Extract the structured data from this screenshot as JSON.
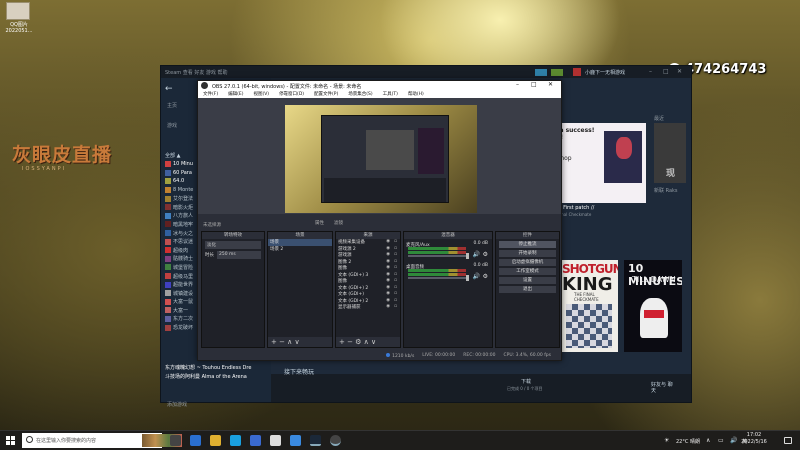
{
  "desktop": {
    "icon_label": "QQ图片\n2022051..."
  },
  "streamer": {
    "logo": "灰眼皮直播",
    "subtitle": "IOSSYANPI"
  },
  "qq": {
    "number": "474264743"
  },
  "steam": {
    "nav": "Steam  查看  好友  游戏  帮助",
    "user": "小鹿下一无相游戏",
    "home": "主页",
    "section": "游戏",
    "list_header": "全部 ▲",
    "games": [
      {
        "name": "10 Minu",
        "color": "#d04040"
      },
      {
        "name": "60 Para",
        "color": "#4060a0"
      },
      {
        "name": "64.0",
        "color": "#a0a040"
      },
      {
        "name": "8 Monte",
        "color": "#c08030"
      },
      {
        "name": "艾尔登法",
        "color": "#a08030"
      },
      {
        "name": "暗影火炬",
        "color": "#803030"
      },
      {
        "name": "八方旅人",
        "color": "#4080c0"
      },
      {
        "name": "暗黑地牢",
        "color": "#602020"
      },
      {
        "name": "冰与火之",
        "color": "#3060a0"
      },
      {
        "name": "不思议迷",
        "color": "#c05050"
      },
      {
        "name": "超级肉",
        "color": "#d03030"
      },
      {
        "name": "骷髅骑士",
        "color": "#804080"
      },
      {
        "name": "城堡冒险",
        "color": "#408040"
      },
      {
        "name": "超级马里",
        "color": "#c04040"
      },
      {
        "name": "超能世界",
        "color": "#4040c0"
      },
      {
        "name": "城镇建设",
        "color": "#a0a0a0"
      },
      {
        "name": "大富一鼠",
        "color": "#d05050"
      },
      {
        "name": "大富一",
        "color": "#c06060"
      },
      {
        "name": "东方二次",
        "color": "#6060a0"
      },
      {
        "name": "恐龙破坏",
        "color": "#a04040"
      }
    ],
    "bottom_items": [
      "东方魂魄幻想 ~ Touhou Endless Dre",
      "斗技场的阿利曼 Alma of the Arena"
    ],
    "add_game": "添加游戏",
    "more": "接下来畅玩",
    "download": "下载",
    "download_sub": "已完成 0 / 0 个项目",
    "friends": "好友与\n聊天",
    "news": {
      "line1": "se is a success!",
      "line2": "k you!!",
      "line3": "ixes)",
      "line4": "plans",
      "line5": "Workshop",
      "title": "release! / First patch //",
      "sub": "King: The Final Checkmate"
    },
    "news2_label": "新联  Raks",
    "news2_char": "现",
    "recent_label": "最近",
    "covers": {
      "c1_line1": "SHOTGUN",
      "c1_line2": "KING",
      "c1_line3": "THE FINAL CHECKMATE",
      "c2_line1": "10 MINUTES",
      "c2_line2": "TILL DAWN"
    }
  },
  "obs": {
    "title": "OBS 27.0.1 (64-bit, windows) - 配置文件: 未命名 - 场景: 未命名",
    "menu": [
      "文件(F)",
      "编辑(E)",
      "视图(V)",
      "停靠窗口(D)",
      "配置文件(P)",
      "场景集合(S)",
      "工具(T)",
      "帮助(H)"
    ],
    "scene_label": "未选择源",
    "ctrl_row": [
      "属性",
      "滤镜"
    ],
    "docks": {
      "transitions": {
        "header": "转场特效",
        "type": "淡化",
        "duration_label": "时长",
        "duration": "250 ms"
      },
      "scenes": {
        "header": "场景",
        "items": [
          "场景",
          "场景 2"
        ]
      },
      "sources": {
        "header": "来源",
        "items": [
          "视频采集设备",
          "游戏源 2",
          "游戏源",
          "图像 2",
          "图像",
          "文本 (GDI+) 3",
          "图像",
          "文本 (GDI+) 2",
          "文本 (GDI+)",
          "文本 (GDI+) 2",
          "显示器捕获"
        ]
      },
      "mixer": {
        "header": "混音器",
        "channels": [
          {
            "name": "麦克风/Aux",
            "db": "0.0 dB"
          },
          {
            "name": "桌面音频",
            "db": "0.0 dB"
          }
        ]
      },
      "controls": {
        "header": "控件",
        "buttons": [
          "停止推流",
          "开始录制",
          "启动虚拟摄像机",
          "工作室模式",
          "设置",
          "退出"
        ]
      }
    },
    "status": {
      "live": "LIVE: 00:00:00",
      "rec": "REC: 00:00:00",
      "cpu": "CPU: 3.4%, 60.00 fps",
      "kbps": "1210 kb/s"
    }
  },
  "taskbar": {
    "search_placeholder": "在这里输入你要搜索的内容",
    "weather": "22°C 晴朗",
    "ime": "英",
    "time": "17:02",
    "date": "2022/5/16"
  }
}
